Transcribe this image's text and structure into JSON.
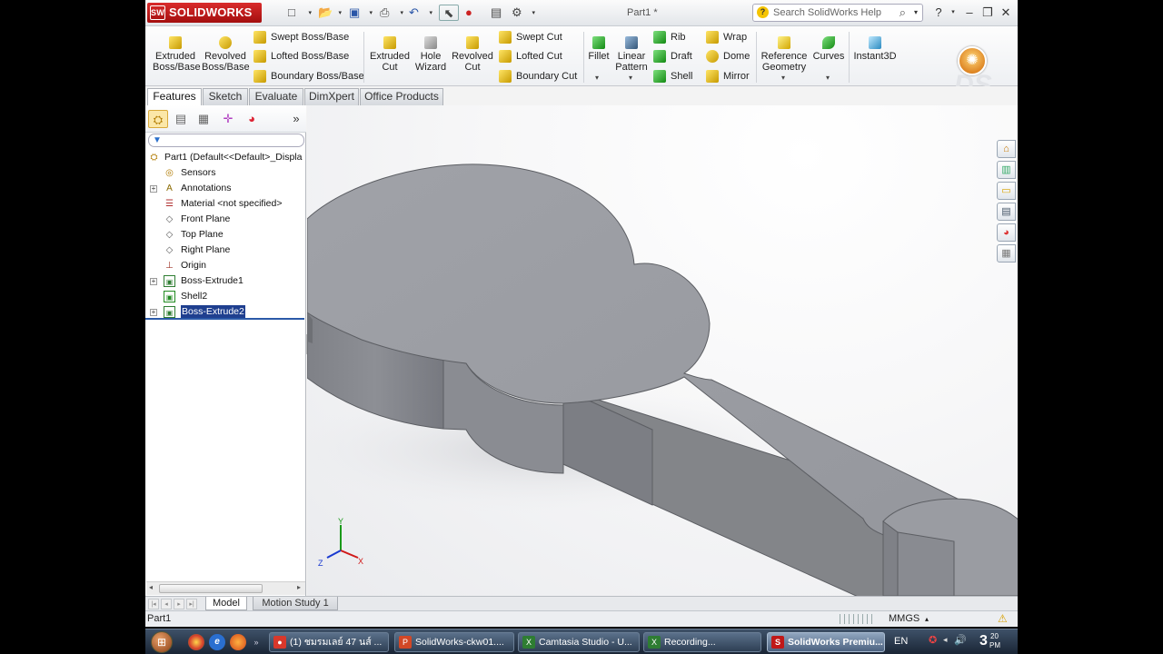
{
  "titlebar": {
    "brand": "SOLIDWORKS",
    "doc_title": "Part1 *",
    "search_placeholder": "Search SolidWorks Help",
    "help_label": "?"
  },
  "ribbon": {
    "extruded_boss": "Extruded Boss/Base",
    "revolved_boss": "Revolved Boss/Base",
    "swept_boss": "Swept Boss/Base",
    "lofted_boss": "Lofted Boss/Base",
    "boundary_boss": "Boundary Boss/Base",
    "extruded_cut": "Extruded Cut",
    "hole_wizard": "Hole Wizard",
    "revolved_cut": "Revolved Cut",
    "swept_cut": "Swept Cut",
    "lofted_cut": "Lofted Cut",
    "boundary_cut": "Boundary Cut",
    "fillet": "Fillet",
    "linear_pattern": "Linear Pattern",
    "rib": "Rib",
    "draft": "Draft",
    "shell": "Shell",
    "wrap": "Wrap",
    "dome": "Dome",
    "mirror": "Mirror",
    "reference_geometry": "Reference Geometry",
    "curves": "Curves",
    "instant3d": "Instant3D"
  },
  "tabs": [
    "Features",
    "Sketch",
    "Evaluate",
    "DimXpert",
    "Office Products"
  ],
  "active_tab": "Features",
  "feature_tree": {
    "root": "Part1  (Default<<Default>_Displa",
    "items": [
      {
        "label": "Sensors",
        "icon": "sensor-icon",
        "expandable": false
      },
      {
        "label": "Annotations",
        "icon": "annotations-icon",
        "expandable": true
      },
      {
        "label": "Material <not specified>",
        "icon": "material-icon",
        "expandable": false
      },
      {
        "label": "Front Plane",
        "icon": "plane-icon",
        "expandable": false
      },
      {
        "label": "Top Plane",
        "icon": "plane-icon",
        "expandable": false
      },
      {
        "label": "Right Plane",
        "icon": "plane-icon",
        "expandable": false
      },
      {
        "label": "Origin",
        "icon": "origin-icon",
        "expandable": false
      },
      {
        "label": "Boss-Extrude1",
        "icon": "extrude-icon",
        "expandable": true
      },
      {
        "label": "Shell2",
        "icon": "shell-icon",
        "expandable": false
      },
      {
        "label": "Boss-Extrude2",
        "icon": "extrude-icon",
        "expandable": true,
        "selected": true
      }
    ]
  },
  "bottom_tabs": [
    "Model",
    "Motion Study 1"
  ],
  "status": {
    "left": "Part1",
    "units": "MMGS"
  },
  "triad": {
    "x": "X",
    "y": "Y",
    "z": "Z"
  },
  "taskbar": {
    "buttons": [
      {
        "label": "(1) ชมรมเลย์ 47 นส์ ...",
        "icon": "chrome-icon",
        "color": "#d9382b"
      },
      {
        "label": "SolidWorks-ckw01....",
        "icon": "powerpoint-icon",
        "color": "#d24726"
      },
      {
        "label": "Camtasia Studio - U...",
        "icon": "camtasia-icon",
        "color": "#2e7d32"
      },
      {
        "label": "Recording...",
        "icon": "camtasia-icon",
        "color": "#2e7d32"
      },
      {
        "label": "SolidWorks Premiu...",
        "icon": "solidworks-icon",
        "color": "#c01818"
      }
    ],
    "lang": "EN",
    "clock_time": "3",
    "clock_min": "20",
    "clock_ampm": "PM"
  },
  "colors": {
    "brand_red": "#c01818",
    "model_face": "#9a9ca2",
    "selection": "#1f3f8f"
  }
}
